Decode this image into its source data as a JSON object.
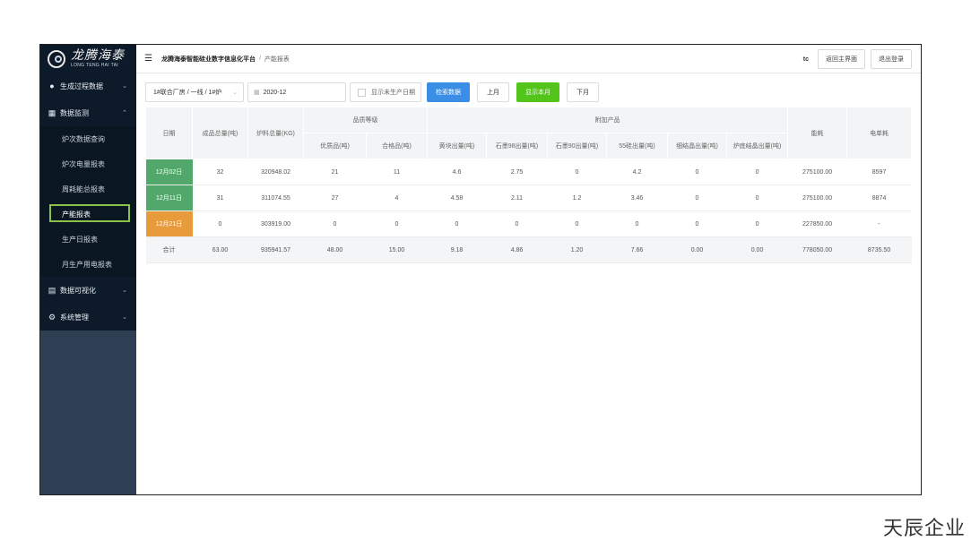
{
  "logo": {
    "cn": "龙腾海泰",
    "en": "LONG TENG HAI TAI"
  },
  "sidebar": {
    "groups": [
      {
        "label": "生成过程数据",
        "icon": "location-pin-icon"
      },
      {
        "label": "数据监测",
        "icon": "calendar-icon"
      },
      {
        "label": "数据可视化",
        "icon": "monitor-icon"
      },
      {
        "label": "系统管理",
        "icon": "gear-icon"
      }
    ],
    "items": [
      "炉次数据查询",
      "炉次电量报表",
      "周耗能总报表",
      "产能报表",
      "生产日报表",
      "月生产用电报表"
    ]
  },
  "header": {
    "platform": "龙腾海泰智能硅业数字信息化平台",
    "separator": "/",
    "page": "产能报表",
    "user": "tc",
    "home_button": "返回主界面",
    "logout_button": "退出登录"
  },
  "toolbar": {
    "select_value": "1#联合厂房 / 一线 / 1#炉",
    "date_value": "2020-12",
    "checkbox_label": "显示未生产日期",
    "search_button": "检索数据",
    "prev_month": "上月",
    "this_month": "显示本月",
    "next_month": "下月"
  },
  "table": {
    "headers": {
      "date": "日期",
      "total_output": "成品总量(吨)",
      "furnace_total": "炉料总量(KG)",
      "quality_group": "品质等级",
      "superior": "优质品(吨)",
      "qualified": "合格品(吨)",
      "byproduct_group": "附加产品",
      "yellow": "黄块出量(吨)",
      "graphite98": "石墨98出量(吨)",
      "graphite90": "石墨90出量(吨)",
      "si55": "55硅出量(吨)",
      "fine_crystal": "细结晶出量(吨)",
      "bottom_crystal": "炉底结晶出量(吨)",
      "power": "能耗",
      "unit_power": "电单耗"
    },
    "rows": [
      {
        "date": "12月02日",
        "date_color": "green",
        "cells": [
          "32",
          "320948.02",
          "21",
          "11",
          "4.6",
          "2.75",
          "0",
          "4.2",
          "0",
          "0",
          "275100.00",
          "8597"
        ]
      },
      {
        "date": "12月11日",
        "date_color": "green",
        "cells": [
          "31",
          "311074.55",
          "27",
          "4",
          "4.58",
          "2.11",
          "1.2",
          "3.46",
          "0",
          "0",
          "275100.00",
          "8874"
        ]
      },
      {
        "date": "12月21日",
        "date_color": "orange",
        "cells": [
          "0",
          "303919.00",
          "0",
          "0",
          "0",
          "0",
          "0",
          "0",
          "0",
          "0",
          "227850.00",
          "-"
        ]
      }
    ],
    "summary": {
      "label": "合计",
      "cells": [
        "63.00",
        "935941.57",
        "48.00",
        "15.00",
        "9.18",
        "4.86",
        "1.20",
        "7.66",
        "0.00",
        "0.00",
        "778050.00",
        "8735.50"
      ]
    }
  },
  "watermark": "天辰企业"
}
